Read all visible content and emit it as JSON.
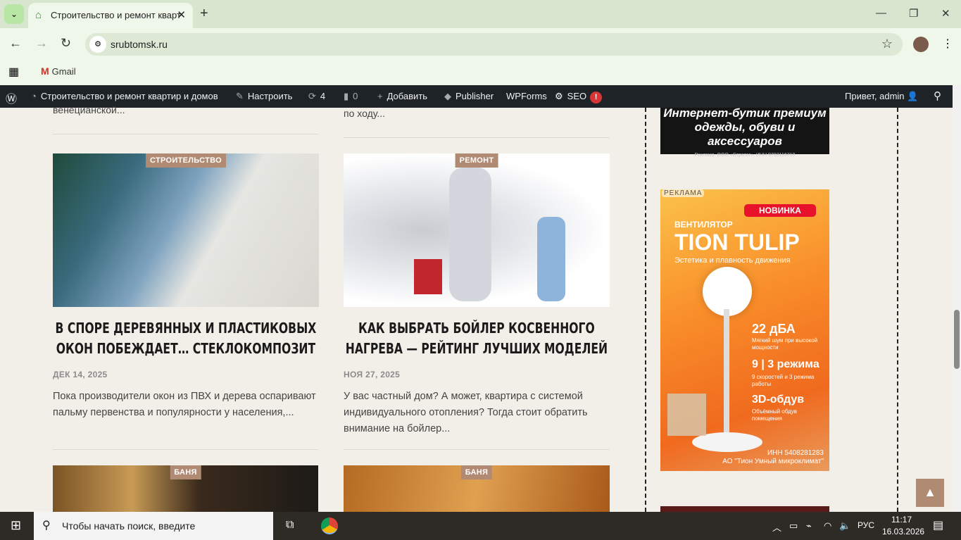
{
  "browser": {
    "tab_title": "Строительство и ремонт кварт",
    "url": "srubtomsk.ru",
    "bookmarks": [
      {
        "label": "Gmail"
      }
    ]
  },
  "wp_admin_bar": {
    "site_name": "Строительство и ремонт квартир и домов",
    "customize": "Настроить",
    "updates_count": "4",
    "comments_count": "0",
    "add_new": "Добавить",
    "publisher": "Publisher",
    "wpforms": "WPForms",
    "seo": "SEO",
    "seo_badge": "!",
    "greeting": "Привет, admin"
  },
  "top_fragments": {
    "left": "венецианской...",
    "right": "по ходу..."
  },
  "posts": [
    {
      "category": "СТРОИТЕЛЬСТВО",
      "title": "В споре деревянных и пластиковых окон побеждает… стеклокомпозит",
      "date": "ДЕК 14, 2025",
      "excerpt": "Пока производители окон из ПВХ и дерева оспаривают пальму первенства и популярности у населения,..."
    },
    {
      "category": "РЕМОНТ",
      "title": "Как выбрать бойлер косвенного нагрева — рейтинг лучших моделей",
      "date": "НОЯ 27, 2025",
      "excerpt": "У вас частный дом? А может, квартира с системой индивидуального отопления? Тогда стоит обратить внимание на бойлер..."
    },
    {
      "category": "БАНЯ"
    },
    {
      "category": "БАНЯ"
    }
  ],
  "ads": {
    "ad1": {
      "line1": "Интернет-бутик премиум",
      "line2": "одежды, обуви и аксессуаров",
      "legal": "Реклама. ООО «Стратег». ИНН 9703116710"
    },
    "ad2": {
      "label": "РЕКЛАМА",
      "badge": "НОВИНКА",
      "pre": "ВЕНТИЛЯТОР",
      "name": "TION TULIP",
      "tagline": "Эстетика и плавность движения",
      "f1": "22 дБА",
      "f1d": "Мягкий шум при высокой мощности",
      "f2": "9 | 3 режима",
      "f2d": "9 скоростей и 3 режима работы",
      "f3": "3D-обдув",
      "f3d": "Объёмный обдув помещения",
      "inn": "ИНН 5408281283",
      "company": "АО \"Тион Умный микроклимат\""
    }
  },
  "taskbar": {
    "search_placeholder": "Чтобы начать поиск, введите",
    "lang": "РУС",
    "time": "11:17",
    "date": "16.03.2026"
  }
}
